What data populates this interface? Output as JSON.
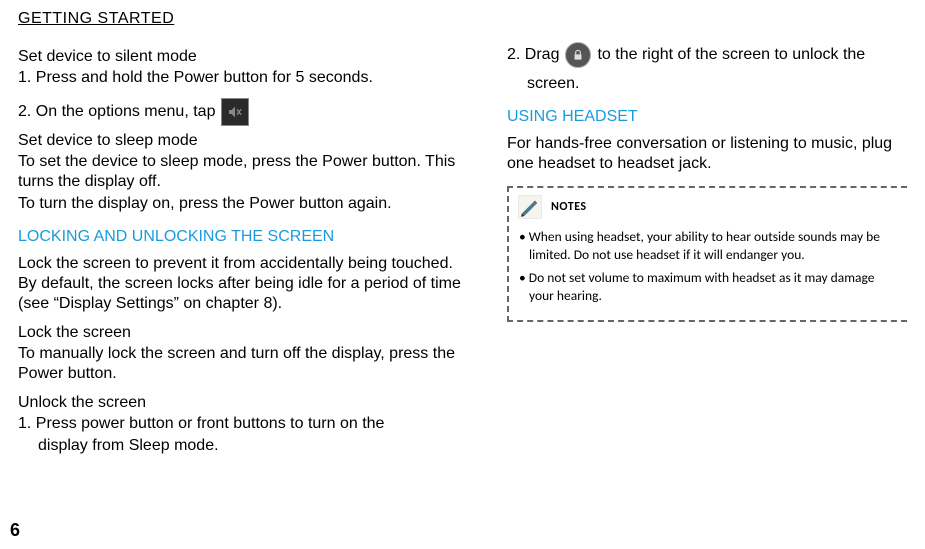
{
  "page": {
    "title": "GETTING STARTED",
    "number": "6"
  },
  "left": {
    "silent_heading": "Set device to silent mode",
    "silent_step1": "1. Press and hold the Power button for 5 seconds.",
    "silent_step2_prefix": "2. On the options menu, tap",
    "sleep_heading": "Set device to sleep mode",
    "sleep_body1": "To set the device to sleep mode, press the Power button. This turns the display off.",
    "sleep_body2": "To turn the display on, press the Power button again.",
    "lock_section": "LOCKING AND UNLOCKING THE SCREEN",
    "lock_intro": "Lock the screen to prevent it from accidentally being touched. By default, the screen locks after being idle for a period of time (see “Display Settings” on chapter 8).",
    "lock_screen_heading": "Lock the screen",
    "lock_screen_body": "To manually lock the screen and turn off the display, press the Power button.",
    "unlock_heading": "Unlock the screen",
    "unlock_step1": "1. Press power button or front buttons to turn on the",
    "unlock_step1_cont": "display from Sleep mode."
  },
  "right": {
    "unlock_step2_prefix": "2. Drag",
    "unlock_step2_suffix": "to the right of the screen to unlock the",
    "unlock_step2_cont": "screen.",
    "headset_section": "USING HEADSET",
    "headset_body": "For hands-free conversation or listening to music, plug one headset to headset jack.",
    "notes_label": "NOTES",
    "note1": "When using headset, your ability to hear outside sounds may be limited. Do not use headset if it will endanger you.",
    "note2": "Do not set volume to maximum with headset as it may damage your hearing."
  }
}
